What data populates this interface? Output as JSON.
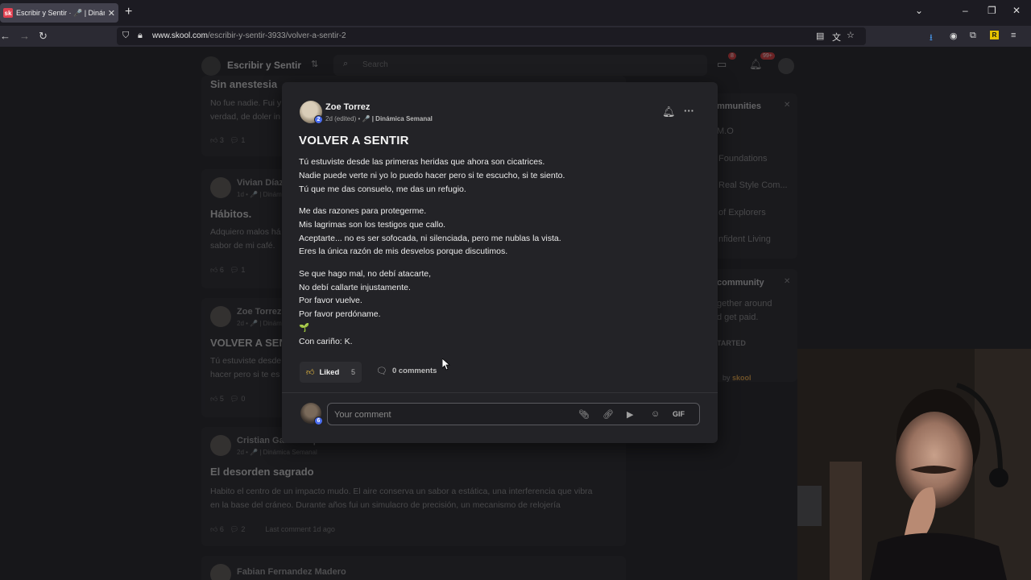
{
  "browser": {
    "tab_title": "Escribir y Sentir · 🎤 | Dinámica",
    "tab_favicon": "sk",
    "url_domain": "www.skool.com",
    "url_path": "/escribir-y-sentir-3933/volver-a-sentir-2"
  },
  "background": {
    "community_name": "Escribir y Sentir",
    "search_placeholder": "Search",
    "chat_badge": "8",
    "notif_badge": "99+",
    "posts": [
      {
        "title": "Sin anestesia",
        "text": "No fue nadie. Fui y\nverdad, de doler in",
        "likes": "3",
        "comments": "1"
      },
      {
        "author": "Vivian Díaz",
        "meta": "1d • 🎤 | Dinám",
        "title": "Hábitos.",
        "text": "Adquiero malos há\nsabor de mi café. ",
        "likes": "6",
        "comments": "1"
      },
      {
        "author": "Zoe Torrez",
        "meta": "2d • 🎤 | Dinámi",
        "title": "VOLVER A SEN",
        "text": "Tú estuviste desde\nhacer pero si te es",
        "likes": "5",
        "comments": "0"
      },
      {
        "author": "Cristian García López",
        "meta": "2d • 🎤 | Dinámica Semanal",
        "title": "El desorden sagrado",
        "text": "Habito el centro de un impacto mudo. El aire conserva un sabor a estática, una interferencia que vibra\nen la base del cráneo. Durante años fui un simulacro de precisión, un mecanismo de relojería",
        "likes": "6",
        "comments": "2",
        "last_comment": "Last comment 1d ago"
      },
      {
        "author": "Fabian Fernandez Madero"
      }
    ],
    "side_communities_title": "mmunities",
    "side_communities": [
      "M.O",
      "Foundations",
      "Real Style Com...",
      "of Explorers",
      "nfident Living"
    ],
    "side_community_title": "community",
    "side_community_text": "gether around\nd get paid.",
    "side_cta": "TARTED",
    "powered_by": "by",
    "skool_logo": "skool"
  },
  "modal": {
    "author": "Zoe Torrez",
    "level": "2",
    "meta_time": "2d (edited) •",
    "meta_category": "| Dinámica Semanal",
    "category_icon": "🎤",
    "title": "VOLVER A SENTIR",
    "stanzas": [
      [
        "Tú estuviste desde las primeras heridas que ahora son cicatrices.",
        "Nadie puede verte ni yo lo puedo hacer pero si te escucho, si te siento.",
        "Tú que me das consuelo, me das un refugio."
      ],
      [
        "Me das razones para protegerme.",
        "Mis lagrimas son los testigos que callo.",
        "Aceptarte... no es ser sofocada, ni silenciada, pero me nublas la vista.",
        "Eres la única razón de mis desvelos porque discutimos."
      ],
      [
        "Se que hago mal, no debí atacarte,",
        "No debí callarte injustamente.",
        "Por favor vuelve.",
        "Por favor perdóname.",
        "🌱",
        "Con cariño: K."
      ]
    ],
    "liked_label": "Liked",
    "like_count": "5",
    "comments_label": "0 comments",
    "comment_placeholder": "Your comment",
    "commenter_level": "6",
    "gif_label": "GIF"
  }
}
